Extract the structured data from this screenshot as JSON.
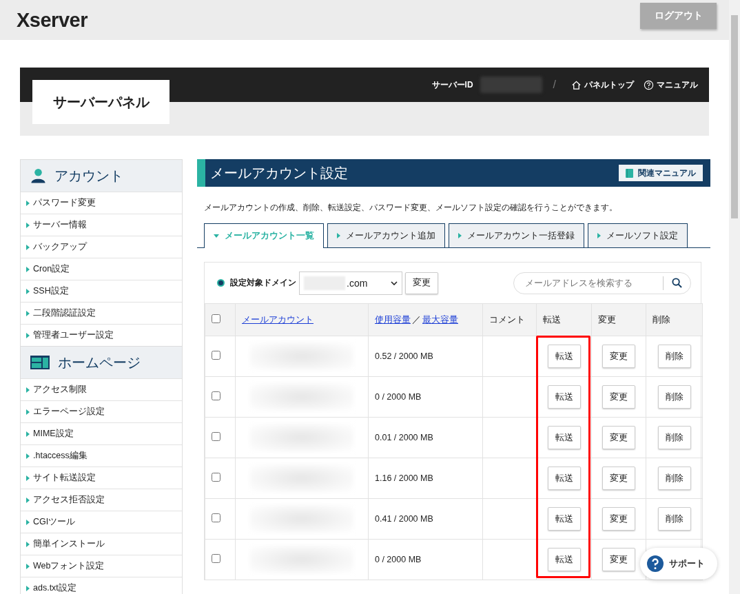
{
  "header": {
    "logo": "Xserver",
    "logout": "ログアウト"
  },
  "panel": {
    "title": "サーバーパネル",
    "server_id_label": "サーバーID",
    "separator": "/",
    "links": [
      {
        "label": "パネルトップ",
        "kind": "home"
      },
      {
        "label": "マニュアル",
        "kind": "help"
      }
    ]
  },
  "sidebar": [
    {
      "title": "アカウント",
      "kind": "account",
      "items": [
        "パスワード変更",
        "サーバー情報",
        "バックアップ",
        "Cron設定",
        "SSH設定",
        "二段階認証設定",
        "管理者ユーザー設定"
      ]
    },
    {
      "title": "ホームページ",
      "kind": "homepage",
      "items": [
        "アクセス制限",
        "エラーページ設定",
        "MIME設定",
        ".htaccess編集",
        "サイト転送設定",
        "アクセス拒否設定",
        "CGIツール",
        "簡単インストール",
        "Webフォント設定",
        "ads.txt設定"
      ]
    }
  ],
  "main": {
    "title": "メールアカウント設定",
    "manual_button": "関連マニュアル",
    "description": "メールアカウントの作成、削除、転送設定、パスワード変更、メールソフト設定の確認を行うことができます。",
    "tabs": [
      {
        "label": "メールアカウント一覧",
        "selected": true
      },
      {
        "label": "メールアカウント追加",
        "selected": false
      },
      {
        "label": "メールアカウント一括登録",
        "selected": false
      },
      {
        "label": "メールソフト設定",
        "selected": false
      }
    ],
    "domain": {
      "label": "設定対象ドメイン",
      "value": ".com",
      "button": "変更"
    },
    "search": {
      "placeholder": "メールアドレスを検索する"
    },
    "table": {
      "columns": [
        {
          "kind": "checkbox",
          "checked": false,
          "highlighted": false
        },
        {
          "kind": "link",
          "parts": [
            "メールアカウント"
          ],
          "highlighted": false
        },
        {
          "kind": "link",
          "parts": [
            "使用容量",
            "／",
            "最大容量"
          ],
          "highlighted": false
        },
        {
          "kind": "text",
          "parts": [
            "コメント"
          ],
          "highlighted": false
        },
        {
          "kind": "text",
          "parts": [
            "転送"
          ],
          "highlighted": true
        },
        {
          "kind": "text",
          "parts": [
            "変更"
          ],
          "highlighted": false
        },
        {
          "kind": "text",
          "parts": [
            "削除"
          ],
          "highlighted": false
        }
      ],
      "rows": [
        {
          "checked": false,
          "usage": "0.52 / 2000 MB",
          "actions": [
            "転送",
            "変更",
            "削除"
          ]
        },
        {
          "checked": false,
          "usage": "0 / 2000 MB",
          "actions": [
            "転送",
            "変更",
            "削除"
          ]
        },
        {
          "checked": false,
          "usage": "0.01 / 2000 MB",
          "actions": [
            "転送",
            "変更",
            "削除"
          ]
        },
        {
          "checked": false,
          "usage": "1.16 / 2000 MB",
          "actions": [
            "転送",
            "変更",
            "削除"
          ]
        },
        {
          "checked": false,
          "usage": "0.41 / 2000 MB",
          "actions": [
            "転送",
            "変更",
            "削除"
          ]
        },
        {
          "checked": false,
          "usage": "0 / 2000 MB",
          "actions": [
            "転送",
            "変更"
          ]
        }
      ]
    }
  },
  "support": {
    "label": "サポート"
  }
}
